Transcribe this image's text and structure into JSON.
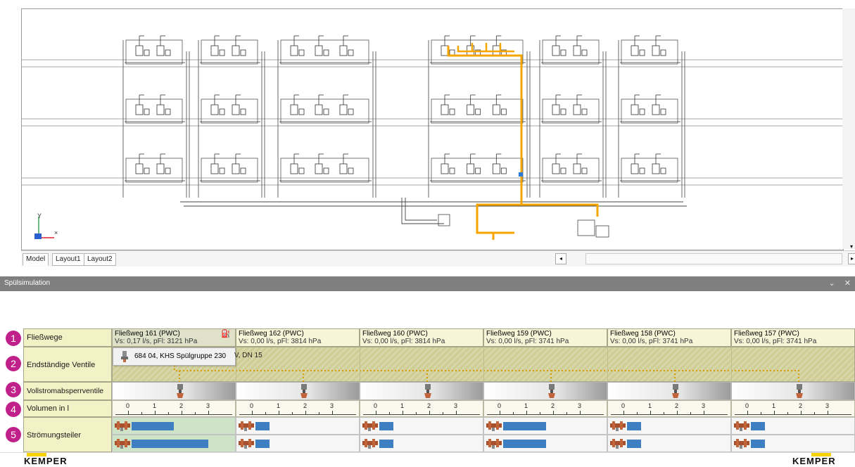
{
  "tabs": {
    "items": [
      "Model",
      "Layout1",
      "Layout2"
    ],
    "active": "Model"
  },
  "panel": {
    "title": "Spülsimulation"
  },
  "rows": {
    "flow_paths": "Fließwege",
    "end_valves": "Endständige Ventile",
    "shutoff_valves": "Vollstromabsperrventile",
    "volume": "Volumen in l",
    "flow_dividers": "Strömungsteiler"
  },
  "badges": [
    "1",
    "2",
    "3",
    "4",
    "5"
  ],
  "paths": [
    {
      "name": "Fließweg 161 (PWC)",
      "vs": "Vs: 0,17 l/s, pFl: 3121 hPa",
      "selected": true
    },
    {
      "name": "Fließweg 162 (PWC)",
      "vs": "Vs: 0,00 l/s, pFl: 3814 hPa",
      "selected": false
    },
    {
      "name": "Fließweg 160 (PWC)",
      "vs": "Vs: 0,00 l/s, pFl: 3814 hPa",
      "selected": false
    },
    {
      "name": "Fließweg 159 (PWC)",
      "vs": "Vs: 0,00 l/s, pFl: 3741 hPa",
      "selected": false
    },
    {
      "name": "Fließweg 158 (PWC)",
      "vs": "Vs: 0,00 l/s, pFl: 3741 hPa",
      "selected": false
    },
    {
      "name": "Fließweg 157 (PWC)",
      "vs": "Vs: 0,00 l/s, pFl: 3741 hPa",
      "selected": false
    }
  ],
  "volume_ticks": [
    "0",
    "1",
    "2",
    "3"
  ],
  "flow_fill": [
    {
      "top": 0.44,
      "bottom": 0.8
    },
    {
      "top": 0.15,
      "bottom": 0.15
    },
    {
      "top": 0.15,
      "bottom": 0.15
    },
    {
      "top": 0.45,
      "bottom": 0.45
    },
    {
      "top": 0.15,
      "bottom": 0.15
    },
    {
      "top": 0.15,
      "bottom": 0.15
    }
  ],
  "tooltip": {
    "text": "684 04, KHS Spülgruppe 230",
    "rest": "V, DN 15"
  },
  "branding": {
    "logo": "KEMPER",
    "accent": "#f6d200",
    "highlight": "#f5a400"
  },
  "icons": [
    "tap-icon",
    "valve-icon",
    "pipe-fitting-icon",
    "axis-icon"
  ]
}
